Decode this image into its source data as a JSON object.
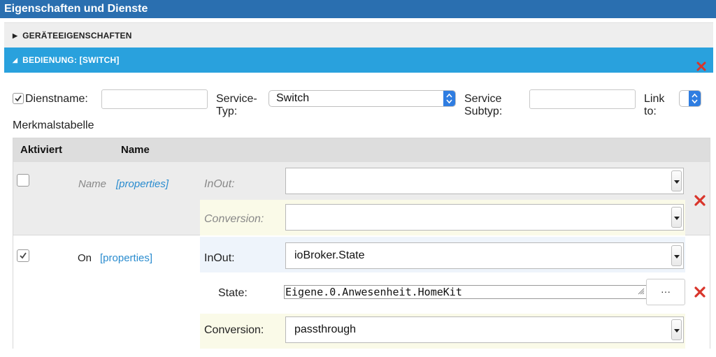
{
  "window": {
    "title": "Eigenschaften und Dienste"
  },
  "sections": {
    "geraete": {
      "label": "GERÄTEEIGENSCHAFTEN",
      "expanded": false
    },
    "bedienung": {
      "label": "BEDIENUNG: [SWITCH]",
      "expanded": true
    }
  },
  "service": {
    "dienstname_label": "Dienstname:",
    "dienstname_value": "",
    "dienstname_checked": true,
    "service_typ_label_1": "Service-",
    "service_typ_label_2": "Typ:",
    "service_typ_value": "Switch",
    "service_subtyp_label_1": "Service",
    "service_subtyp_label_2": "Subtyp:",
    "service_subtyp_value": "",
    "link_label_1": "Link",
    "link_label_2": "to:",
    "link_value": ""
  },
  "merkmal": {
    "title": "Merkmalstabelle",
    "headers": {
      "aktiviert": "Aktiviert",
      "name": "Name"
    },
    "rows": [
      {
        "active": false,
        "name": "Name",
        "props_link": "[properties]",
        "inout_label": "InOut:",
        "inout_value": "",
        "conversion_label": "Conversion:",
        "conversion_value": ""
      },
      {
        "active": true,
        "name": "On",
        "props_link": "[properties]",
        "inout_label": "InOut:",
        "inout_value": "ioBroker.State",
        "state_label": "State:",
        "state_value": "Eigene.0.Anwesenheit.HomeKit",
        "state_button": "···",
        "conversion_label": "Conversion:",
        "conversion_value": "passthrough"
      }
    ]
  },
  "colors": {
    "title_bar": "#2a6fb0",
    "accent": "#29a1dd",
    "delete": "#d9352b",
    "link": "#2a8ccf"
  }
}
